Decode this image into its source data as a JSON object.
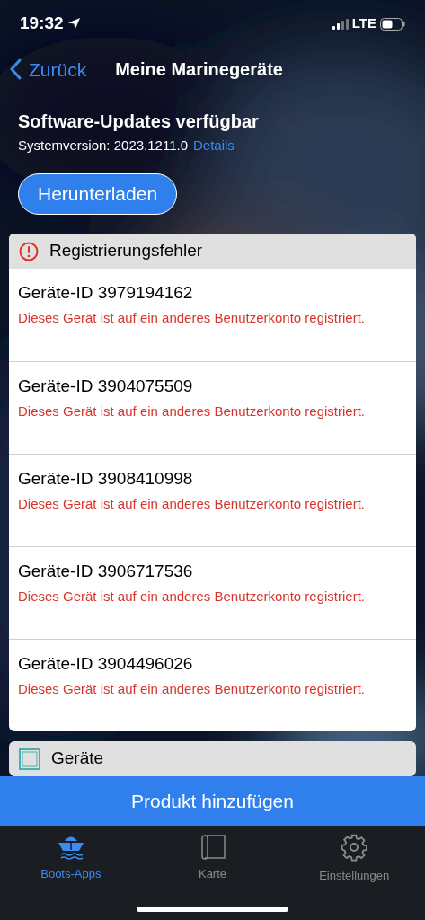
{
  "status_bar": {
    "time": "19:32",
    "network": "LTE"
  },
  "nav": {
    "back": "Zurück",
    "title": "Meine Marinegeräte"
  },
  "update": {
    "title": "Software-Updates verfügbar",
    "version": "Systemversion: 2023.1211.0",
    "details_link": "Details",
    "download_button": "Herunterladen"
  },
  "sections": [
    {
      "kind": "error",
      "title": "Registrierungsfehler",
      "items": [
        {
          "title": "Geräte-ID 3979194162",
          "message": "Dieses Gerät ist auf ein anderes Benutzerkonto registriert."
        },
        {
          "title": "Geräte-ID 3904075509",
          "message": "Dieses Gerät ist auf ein anderes Benutzerkonto registriert."
        },
        {
          "title": "Geräte-ID 3908410998",
          "message": "Dieses Gerät ist auf ein anderes Benutzerkonto registriert."
        },
        {
          "title": "Geräte-ID 3906717536",
          "message": "Dieses Gerät ist auf ein anderes Benutzerkonto registriert."
        },
        {
          "title": "Geräte-ID 3904496026",
          "message": "Dieses Gerät ist auf ein anderes Benutzerkonto registriert."
        }
      ]
    },
    {
      "kind": "devices",
      "title": "Geräte"
    }
  ],
  "add_button": "Produkt hinzufügen",
  "tabs": [
    {
      "kind": "boat",
      "label": "Boots-Apps",
      "selected": true
    },
    {
      "kind": "map",
      "label": "Karte",
      "selected": false
    },
    {
      "kind": "settings",
      "label": "Einstellungen",
      "selected": false
    }
  ]
}
